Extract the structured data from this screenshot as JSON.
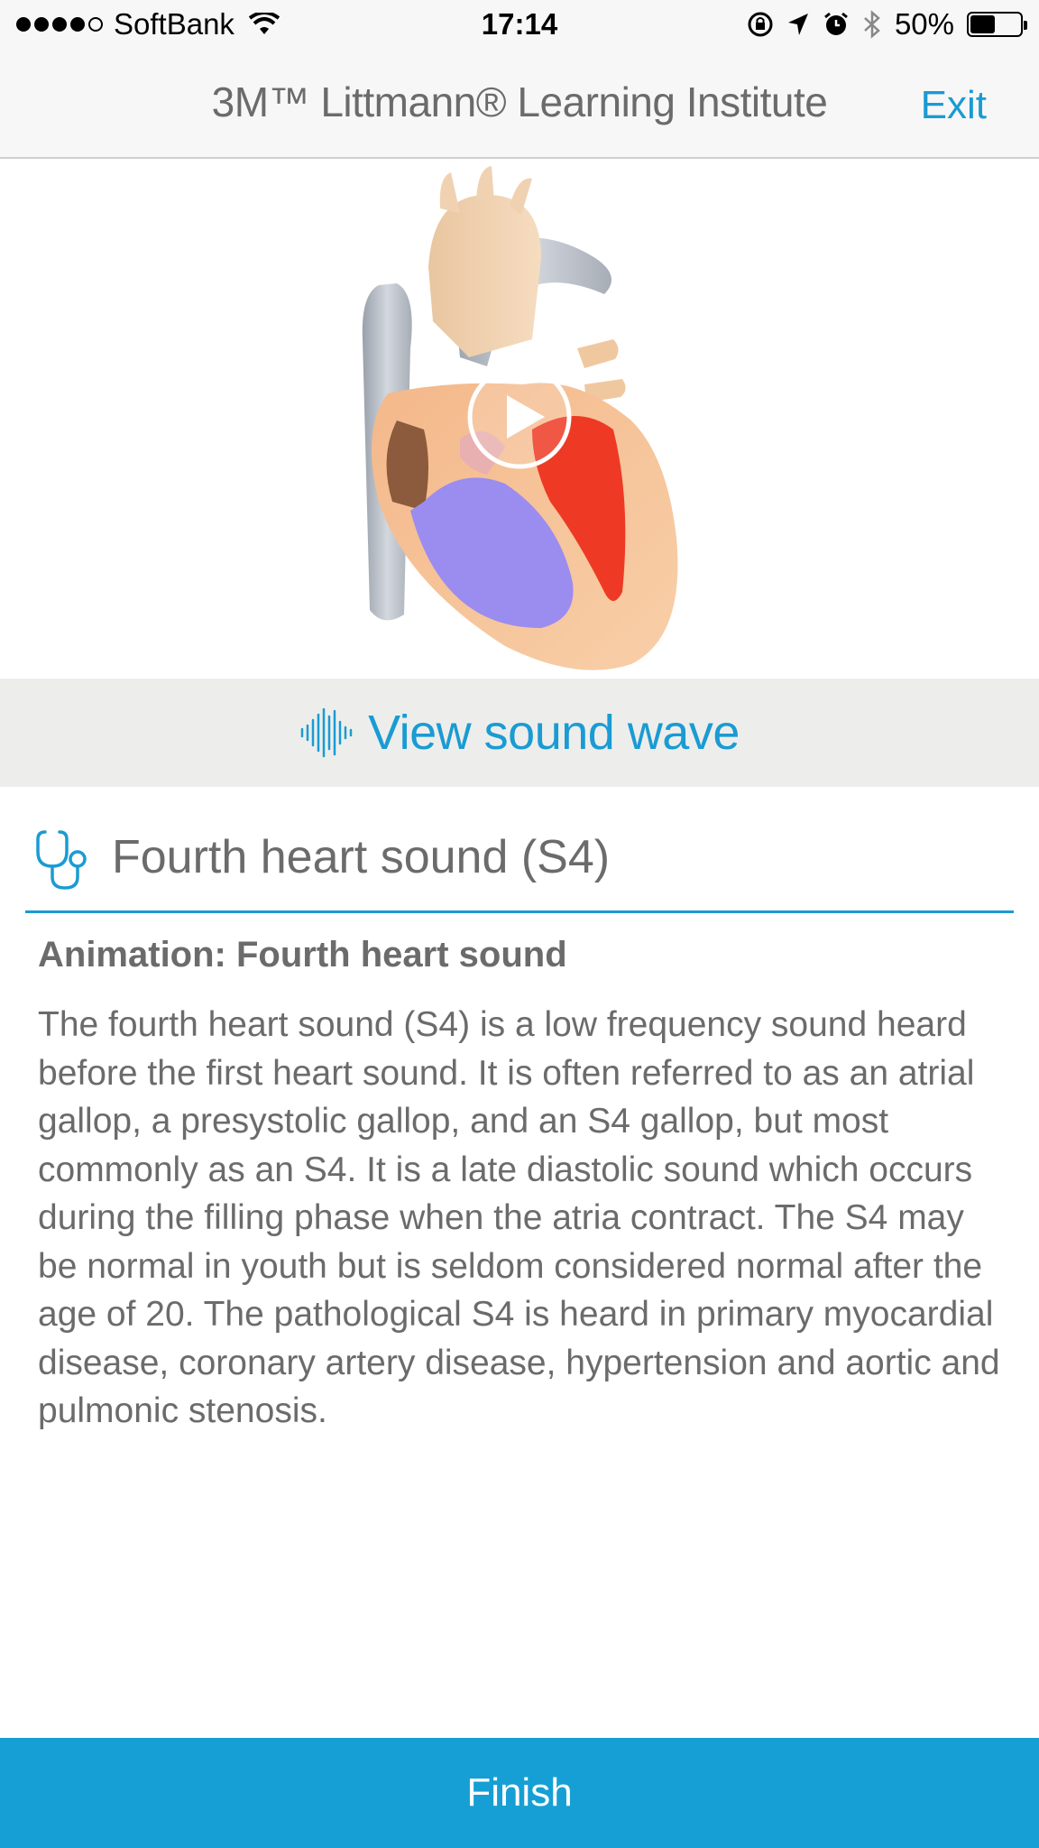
{
  "status_bar": {
    "carrier": "SoftBank",
    "time": "17:14",
    "battery_percent": "50%",
    "battery_level": 0.5
  },
  "nav": {
    "title": "3M™ Littmann® Learning Institute",
    "exit_label": "Exit"
  },
  "media": {
    "play_icon": "play-icon"
  },
  "wave": {
    "label": "View sound wave",
    "icon": "sound-wave-icon"
  },
  "section": {
    "title": "Fourth heart sound (S4)",
    "icon": "stethoscope-icon",
    "accent": "#1a9bd3"
  },
  "content": {
    "animation_title": "Animation: Fourth heart sound",
    "description": "The fourth heart sound (S4) is a low frequency sound heard before the first heart sound. It is often referred to as an atrial gallop, a presystolic gallop, and an S4 gallop, but most commonly as an S4. It is a late diastolic sound which occurs during the filling phase when the atria contract. The S4 may be normal in youth but is seldom considered normal after the age of 20. The pathological S4 is heard in primary myocardial disease, coronary artery disease, hypertension and aortic and pulmonic stenosis."
  },
  "footer": {
    "finish_label": "Finish",
    "color": "#169fd4"
  }
}
